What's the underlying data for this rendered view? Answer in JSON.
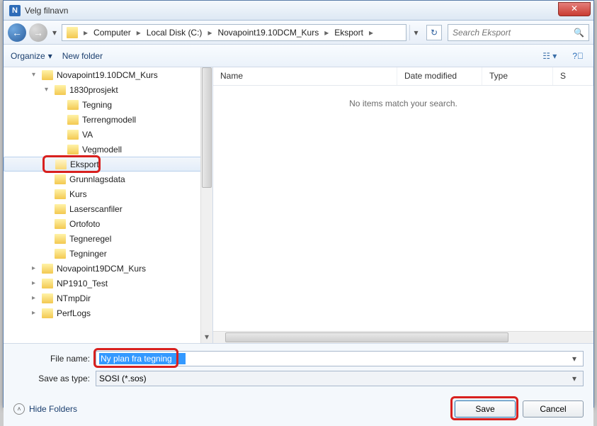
{
  "window": {
    "title": "Velg filnavn"
  },
  "nav": {
    "breadcrumb": [
      "Computer",
      "Local Disk (C:)",
      "Novapoint19.10DCM_Kurs",
      "Eksport"
    ],
    "search_placeholder": "Search Eksport"
  },
  "toolbar": {
    "organize": "Organize",
    "new_folder": "New folder"
  },
  "tree": {
    "items": [
      {
        "label": "Novapoint19.10DCM_Kurs",
        "indent": 0,
        "exp": "▾"
      },
      {
        "label": "1830prosjekt",
        "indent": 1,
        "exp": "▾"
      },
      {
        "label": "Tegning",
        "indent": 2,
        "exp": ""
      },
      {
        "label": "Terrengmodell",
        "indent": 2,
        "exp": ""
      },
      {
        "label": "VA",
        "indent": 2,
        "exp": ""
      },
      {
        "label": "Vegmodell",
        "indent": 2,
        "exp": ""
      },
      {
        "label": "Eksport",
        "indent": 1,
        "exp": "",
        "selected": true,
        "highlight": true
      },
      {
        "label": "Grunnlagsdata",
        "indent": 1,
        "exp": ""
      },
      {
        "label": "Kurs",
        "indent": 1,
        "exp": ""
      },
      {
        "label": "Laserscanfiler",
        "indent": 1,
        "exp": ""
      },
      {
        "label": "Ortofoto",
        "indent": 1,
        "exp": ""
      },
      {
        "label": "Tegneregel",
        "indent": 1,
        "exp": ""
      },
      {
        "label": "Tegninger",
        "indent": 1,
        "exp": ""
      },
      {
        "label": "Novapoint19DCM_Kurs",
        "indent": 0,
        "exp": "▸"
      },
      {
        "label": "NP1910_Test",
        "indent": 0,
        "exp": "▸"
      },
      {
        "label": "NTmpDir",
        "indent": 0,
        "exp": "▸"
      },
      {
        "label": "PerfLogs",
        "indent": 0,
        "exp": "▸"
      }
    ]
  },
  "list": {
    "columns": [
      "Name",
      "Date modified",
      "Type",
      "S"
    ],
    "empty_text": "No items match your search."
  },
  "form": {
    "filename_label": "File name:",
    "filename_value": "Ny plan fra tegning",
    "savetype_label": "Save as type:",
    "savetype_value": "SOSI (*.sos)"
  },
  "footer": {
    "hide_folders": "Hide Folders",
    "save": "Save",
    "cancel": "Cancel"
  }
}
